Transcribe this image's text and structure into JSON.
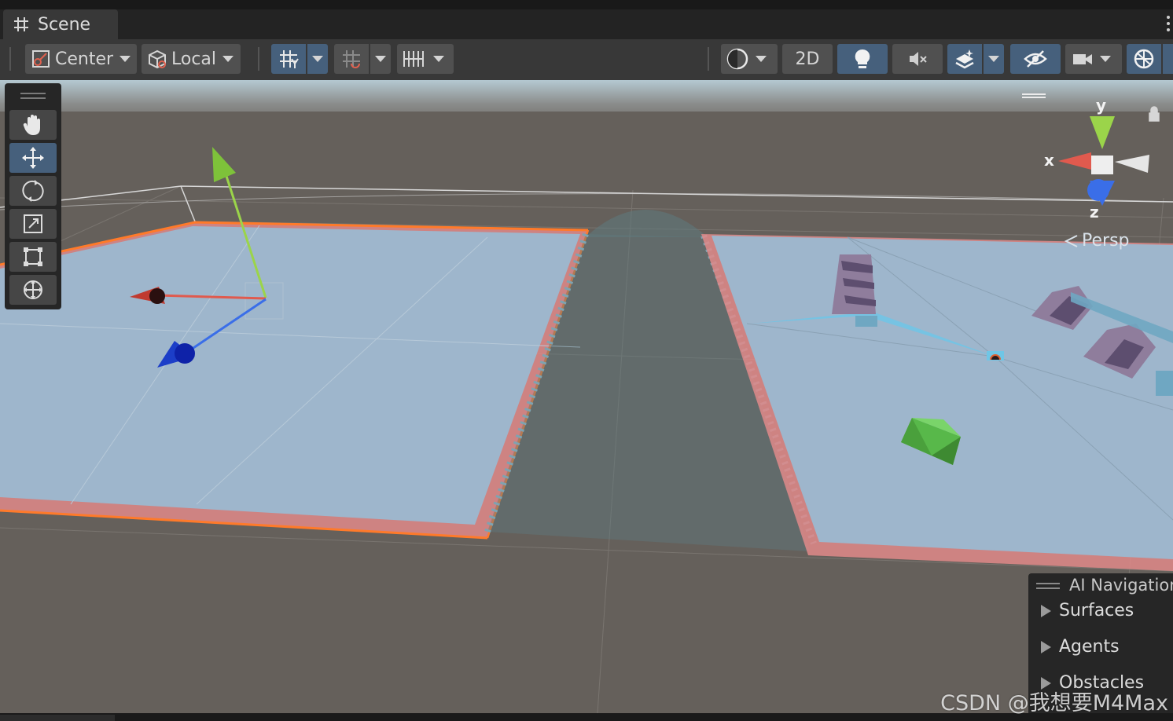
{
  "window": {
    "tab_title": "Scene",
    "tab_icon": "grid-hash-icon"
  },
  "toolbar": {
    "pivot_mode_label": "Center",
    "pivot_rotation_label": "Local",
    "view_2d_label": "2D",
    "icons": [
      "pivot-center-icon",
      "local-cube-icon",
      "grid-snap-icon",
      "increment-snap-icon",
      "grid-ruler-icon",
      "shading-sphere-icon",
      "light-bulb-icon",
      "audio-mute-icon",
      "effects-layers-icon",
      "hidden-objects-icon",
      "camera-icon",
      "gizmos-globe-icon"
    ]
  },
  "tools": {
    "items": [
      "hand-tool-icon",
      "move-tool-icon",
      "rotate-tool-icon",
      "scale-tool-icon",
      "rect-tool-icon",
      "transform-tool-icon"
    ],
    "active": "move-tool-icon"
  },
  "orientation_gizmo": {
    "axis_y": "y",
    "axis_x": "x",
    "axis_z": "z",
    "projection_label": "Persp",
    "colors": {
      "x": "#e05a4e",
      "y": "#9bd44a",
      "z": "#3a6ee8"
    }
  },
  "ai_navigation": {
    "title": "AI Navigation",
    "items": [
      "Surfaces",
      "Agents",
      "Obstacles"
    ]
  },
  "watermark": "CSDN @我想要M4Max",
  "colors": {
    "toolbar_active": "#46607c",
    "navmesh": "#9eb6cc",
    "ground": "#65605b",
    "selection_outline": "#ff7a2a"
  }
}
